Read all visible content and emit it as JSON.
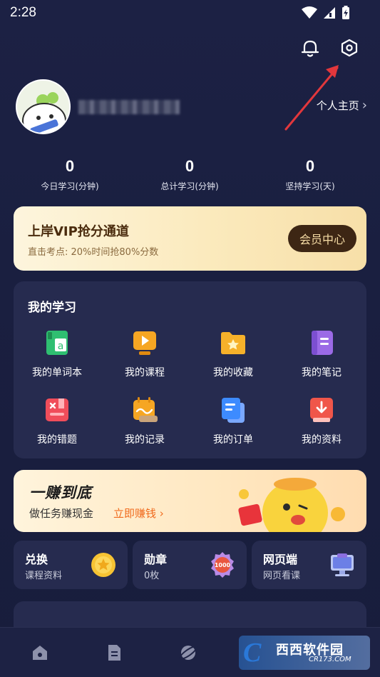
{
  "status": {
    "time": "2:28"
  },
  "profile": {
    "homepage_label": "个人主页"
  },
  "stats": [
    {
      "value": "0",
      "label": "今日学习(分钟)"
    },
    {
      "value": "0",
      "label": "总计学习(分钟)"
    },
    {
      "value": "0",
      "label": "坚持学习(天)"
    }
  ],
  "vip": {
    "title": "上岸VIP抢分通道",
    "subtitle": "直击考点: 20%时间抢80%分数",
    "button": "会员中心"
  },
  "study": {
    "title": "我的学习",
    "items": [
      {
        "label": "我的单词本",
        "icon": "word-book-icon"
      },
      {
        "label": "我的课程",
        "icon": "course-icon"
      },
      {
        "label": "我的收藏",
        "icon": "favorites-folder-icon"
      },
      {
        "label": "我的笔记",
        "icon": "notes-icon"
      },
      {
        "label": "我的错题",
        "icon": "wrong-questions-icon"
      },
      {
        "label": "我的记录",
        "icon": "records-icon"
      },
      {
        "label": "我的订单",
        "icon": "orders-icon"
      },
      {
        "label": "我的资料",
        "icon": "materials-download-icon"
      }
    ]
  },
  "earn": {
    "title": "一赚到底",
    "subtitle": "做任务赚现金",
    "link": "立即赚钱"
  },
  "cards": [
    {
      "title": "兑换",
      "subtitle": "课程资料",
      "icon": "coin-icon"
    },
    {
      "title": "勋章",
      "subtitle": "0枚",
      "icon": "medal-1000-icon"
    },
    {
      "title": "网页端",
      "subtitle": "网页看课",
      "icon": "monitor-icon"
    }
  ],
  "watermark": {
    "text": "西西软件园",
    "url": "CR173.COM"
  },
  "colors": {
    "background": "#1a1f3f",
    "card": "#262b4f",
    "vip_button": "#3d2614",
    "earn_link": "#f06a1d"
  }
}
